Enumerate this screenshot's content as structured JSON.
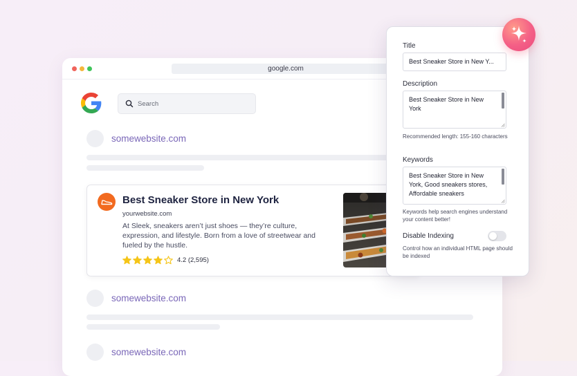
{
  "browser": {
    "url": "google.com",
    "search_placeholder": "Search"
  },
  "results": {
    "site_top": "somewebsite.com",
    "site_mid": "somewebsite.com",
    "site_bottom": "somewebsite.com"
  },
  "featured_result": {
    "title": "Best Sneaker Store in New York",
    "url": "yourwebsite.com",
    "description": "At Sleek, sneakers aren’t just shoes — they’re culture, expression, and lifestyle. Born from a love of streetwear and fueled by the hustle.",
    "rating": 4.2,
    "rating_text": "4.2 (2,595)",
    "stars_filled": 4,
    "stars_total": 5
  },
  "seo_panel": {
    "title_label": "Title",
    "title_value": "Best Sneaker Store in New Y...",
    "description_label": "Description",
    "description_value": "Best Sneaker Store in New York",
    "description_hint": "Recommended length: 155-160 characters",
    "keywords_label": "Keywords",
    "keywords_value": "Best Sneaker Store in New York, Good sneakers stores, Affordable sneakers",
    "keywords_hint": "Keywords help search engines understand your content better!",
    "disable_indexing_label": "Disable Indexing",
    "disable_indexing_on": false,
    "disable_indexing_hint": "Control how an individual HTML page should be indexed"
  },
  "colors": {
    "accent_link": "#7a67b8",
    "brand_orange": "#f26a1f",
    "star": "#f5c518",
    "sparkle_badge": "#f45f86"
  },
  "icons": {
    "sparkle": "sparkle-icon",
    "search": "search-icon",
    "star": "star-icon",
    "sneaker": "sneaker-icon"
  }
}
